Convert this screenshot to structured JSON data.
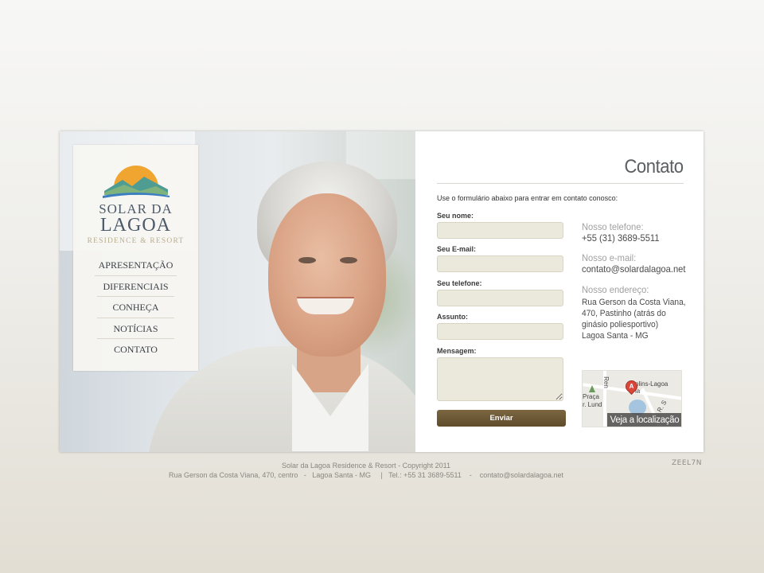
{
  "brand": {
    "name_line1": "SOLAR DA",
    "name_line2": "LAGOA",
    "tagline": "RESIDENCE & RESORT",
    "colors": {
      "sun": "#f0a531",
      "mountain_teal": "#4f9c93",
      "mountain_green": "#7fb37e",
      "water_blue": "#3c7ec2"
    }
  },
  "nav": {
    "items": [
      {
        "label": "APRESENTAÇÃO"
      },
      {
        "label": "DIFERENCIAIS"
      },
      {
        "label": "CONHEÇA"
      },
      {
        "label": "NOTÍCIAS"
      },
      {
        "label": "CONTATO"
      }
    ]
  },
  "contact": {
    "title": "Contato",
    "intro": "Use o formulário abaixo para entrar em contato conosco:",
    "form": {
      "name_label": "Seu nome:",
      "name_value": "",
      "email_label": "Seu E-mail:",
      "email_value": "",
      "phone_label": "Seu telefone:",
      "phone_value": "",
      "subject_label": "Assunto:",
      "subject_value": "",
      "message_label": "Mensagem:",
      "message_value": "",
      "submit_label": "Enviar"
    },
    "info": {
      "phone_label": "Nosso telefone:",
      "phone": "+55 (31) 3689-5511",
      "email_label": "Nosso e-mail:",
      "email": "contato@solardalagoa.net",
      "address_label": "Nosso endereço:",
      "address_lines": [
        "Rua Gerson da Costa Viana,",
        "470, Pastinho (atrás do",
        "ginásio poliesportivo)",
        "Lagoa Santa - MG"
      ]
    },
    "map": {
      "labels": [
        "Praça",
        "r. Lund",
        "olins-Lagoa",
        "ia",
        "Ren",
        "R. S"
      ],
      "pin_letter": "A",
      "view_location": "Veja a localização"
    }
  },
  "footer": {
    "line1": "Solar da Lagoa Residence & Resort - Copyright 2011",
    "line2": "Rua Gerson da Costa Viana, 470, centro   -   Lagoa Santa - MG     |   Tel.: +55 31 3689-5511    -    contato@solardalagoa.net",
    "credit": "ZEEL7N"
  }
}
